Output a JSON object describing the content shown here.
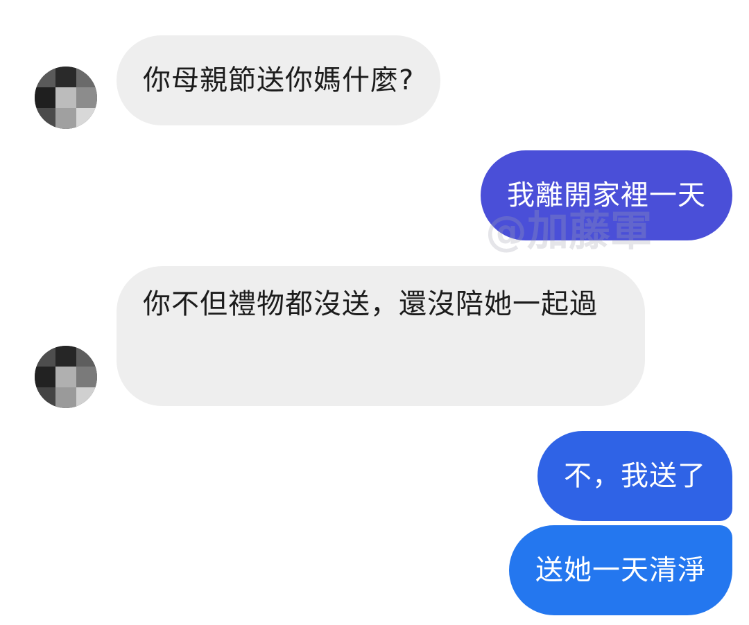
{
  "colors": {
    "incoming_bubble": "#eeeeee",
    "outgoing_gradient_top": "#4a4fd8",
    "outgoing_mid": "#2f63e6",
    "outgoing_bottom": "#2477ef",
    "background": "#ffffff"
  },
  "messages": [
    {
      "direction": "incoming",
      "text": "你母親節送你媽什麼?"
    },
    {
      "direction": "outgoing",
      "text": "我離開家裡一天"
    },
    {
      "direction": "incoming",
      "text": "你不但禮物都沒送，還沒陪她一起過"
    },
    {
      "direction": "outgoing",
      "text": "不，我送了"
    },
    {
      "direction": "outgoing",
      "text": "送她一天清淨"
    }
  ],
  "watermark": "@加藤軍",
  "avatar_icon": "pixelated-avatar-icon"
}
